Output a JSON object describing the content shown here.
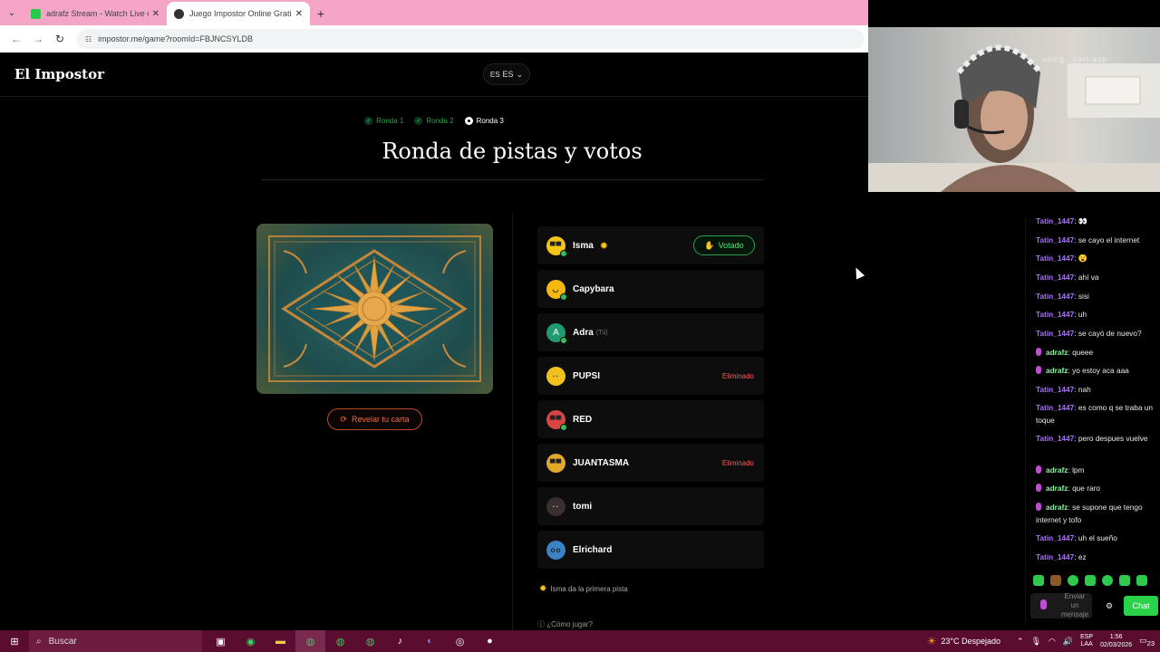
{
  "browser": {
    "tabs": [
      {
        "title": "adrafz Stream - Watch Live on",
        "favicon_color": "#2cc84d"
      },
      {
        "title": "Juego Impostor Online Gratis",
        "favicon_color": "#333333"
      }
    ],
    "url": "impostor.me/game?roomId=FBJNCSYLDB"
  },
  "game": {
    "logo": "El Impostor",
    "language": {
      "flag": "ES",
      "code": "ES"
    },
    "rounds": [
      {
        "label": "Ronda 1",
        "state": "done"
      },
      {
        "label": "Ronda 2",
        "state": "done"
      },
      {
        "label": "Ronda 3",
        "state": "current"
      }
    ],
    "title": "Ronda de pistas y votos",
    "reveal_button": "Revelar tu carta",
    "players": [
      {
        "name": "Isma",
        "avatar_color": "#f5c518",
        "face": "▀▀",
        "status": "voted",
        "status_label": "Votado",
        "starter": true,
        "online": true
      },
      {
        "name": "Capybara",
        "avatar_color": "#f5b80f",
        "face": "◡",
        "online": true
      },
      {
        "name": "Adra",
        "avatar_color": "#1f9b72",
        "face": "A",
        "you_label": "(Tú)",
        "online": true
      },
      {
        "name": "PUPSI",
        "avatar_color": "#f3c11d",
        "face": "··",
        "status": "eliminated",
        "status_label": "Eliminado"
      },
      {
        "name": "RED",
        "avatar_color": "#d94545",
        "face": "▀▀",
        "online": true
      },
      {
        "name": "JUANTASMA",
        "avatar_color": "#e0a92a",
        "face": "▀▀",
        "status": "eliminated",
        "status_label": "Eliminado"
      },
      {
        "name": "tomi",
        "avatar_color": "#3a2e2e",
        "face": "··"
      },
      {
        "name": "Elrichard",
        "avatar_color": "#3b82c4",
        "face": "oo"
      }
    ],
    "hint": "Isma da la primera pista",
    "how_to": "¿Cómo jugar?"
  },
  "webcam": {
    "label": "using...cam.app"
  },
  "chat": {
    "messages": [
      {
        "user": "Tatin_1447",
        "user_color": "#a970ff",
        "text": "👀",
        "mic": false
      },
      {
        "user": "Tatin_1447",
        "user_color": "#a970ff",
        "text": "se cayo el internet",
        "mic": false
      },
      {
        "user": "Tatin_1447",
        "user_color": "#a970ff",
        "text": "😮",
        "mic": false
      },
      {
        "user": "Tatin_1447",
        "user_color": "#a970ff",
        "text": "ahí va",
        "mic": false
      },
      {
        "user": "Tatin_1447",
        "user_color": "#a970ff",
        "text": "sisi",
        "mic": false
      },
      {
        "user": "Tatin_1447",
        "user_color": "#a970ff",
        "text": "uh",
        "mic": false
      },
      {
        "user": "Tatin_1447",
        "user_color": "#a970ff",
        "text": "se cayó de nuevo?",
        "mic": false
      },
      {
        "user": "adrafz",
        "user_color": "#8cf2a5",
        "text": "queee",
        "mic": true
      },
      {
        "user": "adrafz",
        "user_color": "#8cf2a5",
        "text": "yo estoy aca aaa",
        "mic": true
      },
      {
        "user": "Tatin_1447",
        "user_color": "#a970ff",
        "text": "nah",
        "mic": false
      },
      {
        "user": "Tatin_1447",
        "user_color": "#a970ff",
        "text": "es como q se traba un toque",
        "mic": false
      },
      {
        "user": "Tatin_1447",
        "user_color": "#a970ff",
        "text": "pero despues vuelve",
        "mic": false
      },
      {
        "user": "adrafz",
        "user_color": "#8cf2a5",
        "text": "lpm",
        "mic": true
      },
      {
        "user": "adrafz",
        "user_color": "#8cf2a5",
        "text": "que raro",
        "mic": true
      },
      {
        "user": "adrafz",
        "user_color": "#8cf2a5",
        "text": "se supone que tengo internet y tofo",
        "mic": true
      },
      {
        "user": "Tatin_1447",
        "user_color": "#a970ff",
        "text": "uh el sueño",
        "mic": false
      },
      {
        "user": "Tatin_1447",
        "user_color": "#a970ff",
        "text": "ez",
        "mic": false
      }
    ],
    "input_placeholder": "Enviar un mensaje",
    "send_label": "Chat"
  },
  "taskbar": {
    "search_placeholder": "Buscar",
    "weather": "23°C Despejado",
    "lang_line1": "ESP",
    "lang_line2": "LAA",
    "time": "1:56",
    "date": "02/03/2026",
    "notif_count": "23"
  }
}
